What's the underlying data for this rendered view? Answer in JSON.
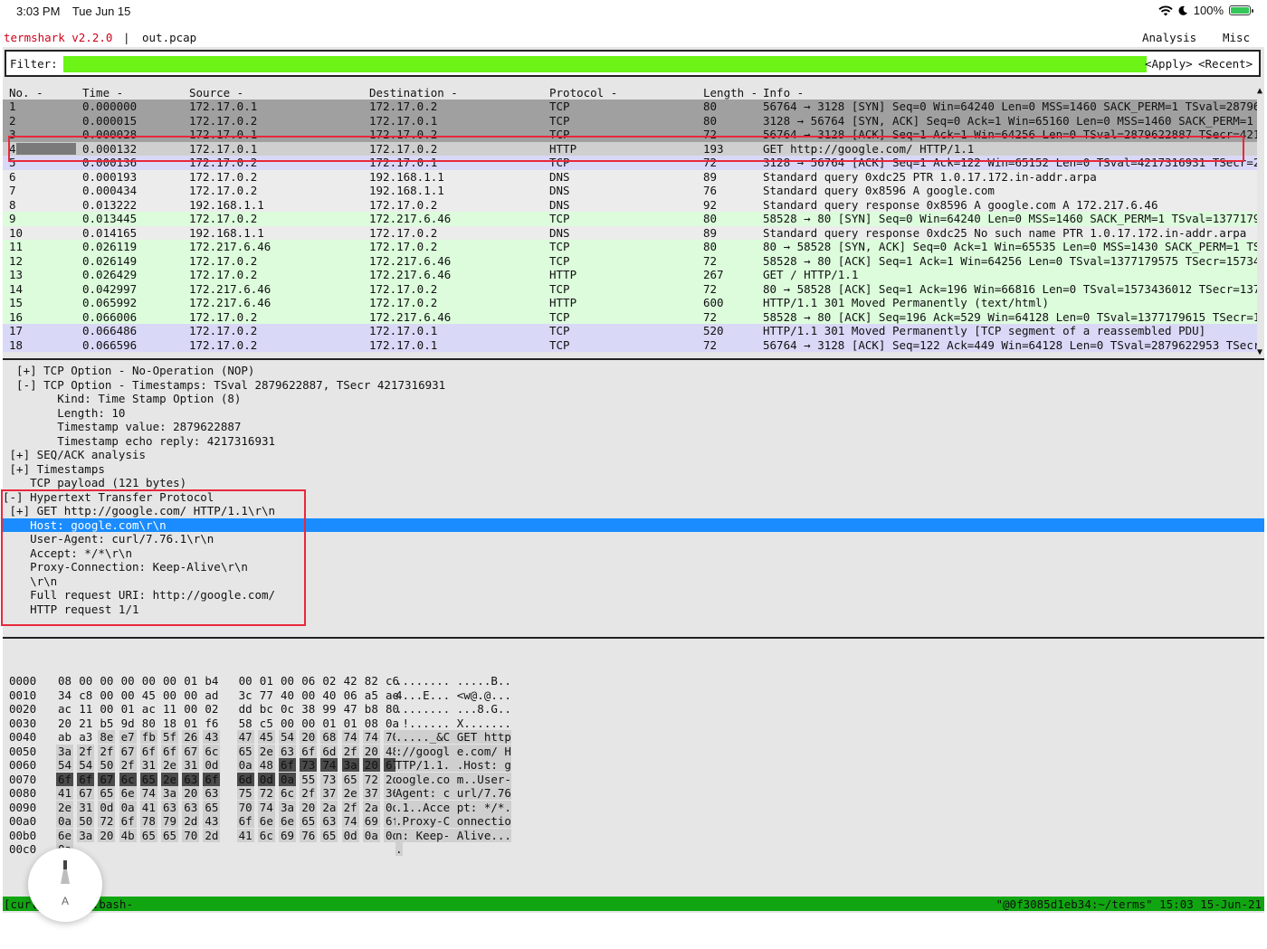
{
  "status_bar": {
    "time": "3:03 PM",
    "date": "Tue Jun 15",
    "battery": "100%",
    "icons": [
      "wifi-icon",
      "moon-icon",
      "battery-charging-icon"
    ]
  },
  "titlebar": {
    "app": "termshark v2.2.0",
    "separator": "|",
    "file": "out.pcap",
    "menus": [
      "Analysis",
      "Misc"
    ]
  },
  "filter": {
    "label": "Filter:",
    "value": "",
    "apply": "<Apply>",
    "recent": "<Recent>"
  },
  "packet_list": {
    "headers": [
      "No. -",
      "Time -",
      "Source -",
      "Destination -",
      "Protocol -",
      "Length -",
      "Info -"
    ],
    "rows": [
      [
        "1",
        "0.000000",
        "172.17.0.1",
        "172.17.0.2",
        "TCP",
        "80",
        "56764 → 3128 [SYN] Seq=0 Win=64240 Len=0 MSS=1460 SACK_PERM=1 TSval=28796"
      ],
      [
        "2",
        "0.000015",
        "172.17.0.2",
        "172.17.0.1",
        "TCP",
        "80",
        "3128 → 56764 [SYN, ACK] Seq=0 Ack=1 Win=65160 Len=0 MSS=1460 SACK_PERM=1"
      ],
      [
        "3",
        "0.000028",
        "172.17.0.1",
        "172.17.0.2",
        "TCP",
        "72",
        "56764 → 3128 [ACK] Seq=1 Ack=1 Win=64256 Len=0 TSval=2879622887 TSecr=421"
      ],
      [
        "4",
        "0.000132",
        "172.17.0.1",
        "172.17.0.2",
        "HTTP",
        "193",
        "GET http://google.com/ HTTP/1.1"
      ],
      [
        "5",
        "0.000136",
        "172.17.0.2",
        "172.17.0.1",
        "TCP",
        "72",
        "3128 → 56764 [ACK] Seq=1 Ack=122 Win=65152 Len=0 TSval=4217316931 TSecr=2"
      ],
      [
        "6",
        "0.000193",
        "172.17.0.2",
        "192.168.1.1",
        "DNS",
        "89",
        "Standard query 0xdc25 PTR 1.0.17.172.in-addr.arpa"
      ],
      [
        "7",
        "0.000434",
        "172.17.0.2",
        "192.168.1.1",
        "DNS",
        "76",
        "Standard query 0x8596 A google.com"
      ],
      [
        "8",
        "0.013222",
        "192.168.1.1",
        "172.17.0.2",
        "DNS",
        "92",
        "Standard query response 0x8596 A google.com A 172.217.6.46"
      ],
      [
        "9",
        "0.013445",
        "172.17.0.2",
        "172.217.6.46",
        "TCP",
        "80",
        "58528 → 80 [SYN] Seq=0 Win=64240 Len=0 MSS=1460 SACK_PERM=1 TSval=1377179"
      ],
      [
        "10",
        "0.014165",
        "192.168.1.1",
        "172.17.0.2",
        "DNS",
        "89",
        "Standard query response 0xdc25 No such name PTR 1.0.17.172.in-addr.arpa"
      ],
      [
        "11",
        "0.026119",
        "172.217.6.46",
        "172.17.0.2",
        "TCP",
        "80",
        "80 → 58528 [SYN, ACK] Seq=0 Ack=1 Win=65535 Len=0 MSS=1430 SACK_PERM=1 TS"
      ],
      [
        "12",
        "0.026149",
        "172.17.0.2",
        "172.217.6.46",
        "TCP",
        "72",
        "58528 → 80 [ACK] Seq=1 Ack=1 Win=64256 Len=0 TSval=1377179575 TSecr=15734"
      ],
      [
        "13",
        "0.026429",
        "172.17.0.2",
        "172.217.6.46",
        "HTTP",
        "267",
        "GET / HTTP/1.1"
      ],
      [
        "14",
        "0.042997",
        "172.217.6.46",
        "172.17.0.2",
        "TCP",
        "72",
        "80 → 58528 [ACK] Seq=1 Ack=196 Win=66816 Len=0 TSval=1573436012 TSecr=137"
      ],
      [
        "15",
        "0.065992",
        "172.217.6.46",
        "172.17.0.2",
        "HTTP",
        "600",
        "HTTP/1.1 301 Moved Permanently  (text/html)"
      ],
      [
        "16",
        "0.066006",
        "172.17.0.2",
        "172.217.6.46",
        "TCP",
        "72",
        "58528 → 80 [ACK] Seq=196 Ack=529 Win=64128 Len=0 TSval=1377179615 TSecr=1"
      ],
      [
        "17",
        "0.066486",
        "172.17.0.2",
        "172.17.0.1",
        "TCP",
        "520",
        "HTTP/1.1 301 Moved Permanently  [TCP segment of a reassembled PDU]"
      ],
      [
        "18",
        "0.066596",
        "172.17.0.2",
        "172.17.0.1",
        "TCP",
        "72",
        "56764 → 3128 [ACK] Seq=122 Ack=449 Win=64128 Len=0 TSval=2879622953 TSecr"
      ]
    ],
    "row_colors": [
      "#a0a0a0",
      "#a0a0a0",
      "#a0a0a0",
      "#cfcfcf",
      "#dad8f7",
      "#ececec",
      "#ececec",
      "#ececec",
      "#dcfcdc",
      "#ececec",
      "#dcfcdc",
      "#dcfcdc",
      "#dcfcdc",
      "#dcfcdc",
      "#dcfcdc",
      "#dcfcdc",
      "#dad8f7",
      "#dad8f7"
    ],
    "scroll_up": "▲",
    "scroll_down": "▼"
  },
  "details": {
    "lines": [
      "  [+] TCP Option - No-Operation (NOP)",
      "  [-] TCP Option - Timestamps: TSval 2879622887, TSecr 4217316931",
      "        Kind: Time Stamp Option (8)",
      "        Length: 10",
      "        Timestamp value: 2879622887",
      "        Timestamp echo reply: 4217316931",
      " [+] SEQ/ACK analysis",
      " [+] Timestamps",
      "    TCP payload (121 bytes)",
      "[-] Hypertext Transfer Protocol",
      " [+] GET http://google.com/ HTTP/1.1\\r\\n",
      "    Host: google.com\\r\\n",
      "    User-Agent: curl/7.76.1\\r\\n",
      "    Accept: */*\\r\\n",
      "    Proxy-Connection: Keep-Alive\\r\\n",
      "    \\r\\n",
      "    Full request URI: http://google.com/",
      "    HTTP request 1/1"
    ],
    "highlight_index": 11,
    "highlight_color": "#1a8cff"
  },
  "hex": {
    "rows": [
      {
        "off": "0000",
        "bytes": [
          "08",
          "00",
          "00",
          "00",
          "00",
          "00",
          "01",
          "b4",
          "00",
          "01",
          "00",
          "06",
          "02",
          "42",
          "82",
          "c6"
        ],
        "ascii": "........ .....B.."
      },
      {
        "off": "0010",
        "bytes": [
          "34",
          "c8",
          "00",
          "00",
          "45",
          "00",
          "00",
          "ad",
          "3c",
          "77",
          "40",
          "00",
          "40",
          "06",
          "a5",
          "ae"
        ],
        "ascii": "4...E... <w@.@..."
      },
      {
        "off": "0020",
        "bytes": [
          "ac",
          "11",
          "00",
          "01",
          "ac",
          "11",
          "00",
          "02",
          "dd",
          "bc",
          "0c",
          "38",
          "99",
          "47",
          "b8",
          "80"
        ],
        "ascii": "........ ...8.G.."
      },
      {
        "off": "0030",
        "bytes": [
          "20",
          "21",
          "b5",
          "9d",
          "80",
          "18",
          "01",
          "f6",
          "58",
          "c5",
          "00",
          "00",
          "01",
          "01",
          "08",
          "0a"
        ],
        "ascii": " !...... X......."
      },
      {
        "off": "0040",
        "bytes": [
          "ab",
          "a3",
          "8e",
          "e7",
          "fb",
          "5f",
          "26",
          "43",
          "47",
          "45",
          "54",
          "20",
          "68",
          "74",
          "74",
          "70"
        ],
        "ascii": "....._&C GET http"
      },
      {
        "off": "0050",
        "bytes": [
          "3a",
          "2f",
          "2f",
          "67",
          "6f",
          "6f",
          "67",
          "6c",
          "65",
          "2e",
          "63",
          "6f",
          "6d",
          "2f",
          "20",
          "48"
        ],
        "ascii": "://googl e.com/ H"
      },
      {
        "off": "0060",
        "bytes": [
          "54",
          "54",
          "50",
          "2f",
          "31",
          "2e",
          "31",
          "0d",
          "0a",
          "48",
          "6f",
          "73",
          "74",
          "3a",
          "20",
          "67"
        ],
        "ascii": "TTP/1.1. .Host: g"
      },
      {
        "off": "0070",
        "bytes": [
          "6f",
          "6f",
          "67",
          "6c",
          "65",
          "2e",
          "63",
          "6f",
          "6d",
          "0d",
          "0a",
          "55",
          "73",
          "65",
          "72",
          "2d"
        ],
        "ascii": "oogle.co m..User-"
      },
      {
        "off": "0080",
        "bytes": [
          "41",
          "67",
          "65",
          "6e",
          "74",
          "3a",
          "20",
          "63",
          "75",
          "72",
          "6c",
          "2f",
          "37",
          "2e",
          "37",
          "36"
        ],
        "ascii": "Agent: c url/7.76"
      },
      {
        "off": "0090",
        "bytes": [
          "2e",
          "31",
          "0d",
          "0a",
          "41",
          "63",
          "63",
          "65",
          "70",
          "74",
          "3a",
          "20",
          "2a",
          "2f",
          "2a",
          "0d"
        ],
        "ascii": ".1..Acce pt: */*."
      },
      {
        "off": "00a0",
        "bytes": [
          "0a",
          "50",
          "72",
          "6f",
          "78",
          "79",
          "2d",
          "43",
          "6f",
          "6e",
          "6e",
          "65",
          "63",
          "74",
          "69",
          "6f"
        ],
        "ascii": ".Proxy-C onnectio"
      },
      {
        "off": "00b0",
        "bytes": [
          "6e",
          "3a",
          "20",
          "4b",
          "65",
          "65",
          "70",
          "2d",
          "41",
          "6c",
          "69",
          "76",
          "65",
          "0d",
          "0a",
          "0d"
        ],
        "ascii": "n: Keep- Alive..."
      },
      {
        "off": "00c0",
        "bytes": [
          "0a"
        ],
        "ascii": "."
      }
    ],
    "dark_color": "#4a4a4a",
    "payload_color": "#cfcfcf"
  },
  "tmux": {
    "left": "[curl_blog* 1:bash-",
    "right": "\"@0f3085d1eb34:~/terms\" 15:03 15-Jun-21"
  },
  "pencil_button": {
    "letter": "A",
    "icon": "pencil-icon"
  }
}
